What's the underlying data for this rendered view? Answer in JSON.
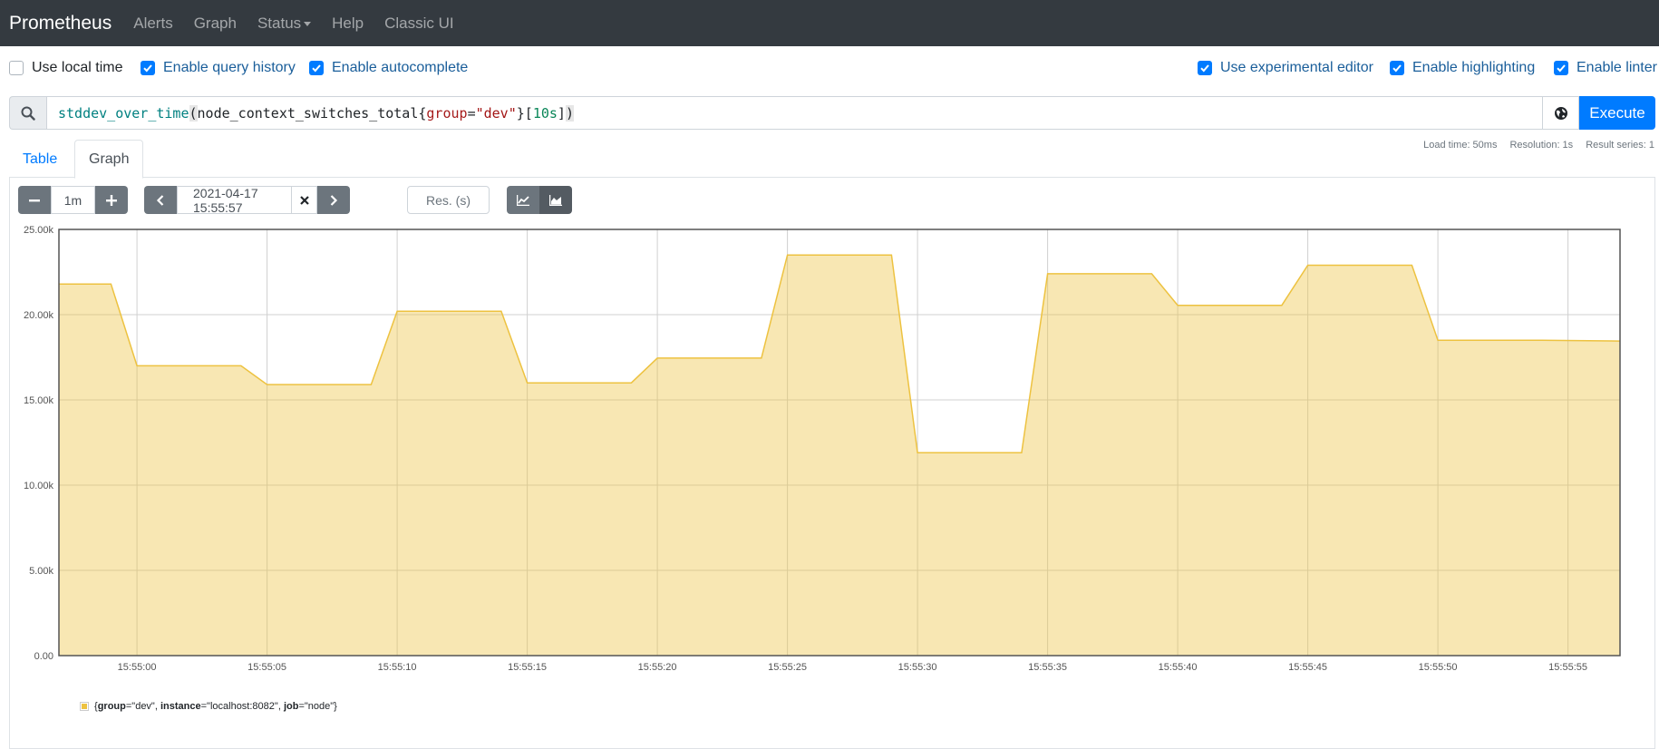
{
  "navbar": {
    "brand": "Prometheus",
    "links": [
      "Alerts",
      "Graph",
      "Status",
      "Help",
      "Classic UI"
    ]
  },
  "options": {
    "use_local_time": {
      "label": "Use local time",
      "checked": false
    },
    "enable_query_history": {
      "label": "Enable query history",
      "checked": true
    },
    "enable_autocomplete": {
      "label": "Enable autocomplete",
      "checked": true
    },
    "use_experimental_editor": {
      "label": "Use experimental editor",
      "checked": true
    },
    "enable_highlighting": {
      "label": "Enable highlighting",
      "checked": true
    },
    "enable_linter": {
      "label": "Enable linter",
      "checked": true
    }
  },
  "query": {
    "function": "stddev_over_time",
    "metric": "node_context_switches_total",
    "label_name": "group",
    "label_value": "\"dev\"",
    "range": "10s"
  },
  "execute_label": "Execute",
  "stats": {
    "load_time": "Load time: 50ms",
    "resolution": "Resolution: 1s",
    "result_series": "Result series: 1"
  },
  "tabs": [
    "Table",
    "Graph"
  ],
  "active_tab": "Graph",
  "graph_controls": {
    "range": "1m",
    "end_time": "2021-04-17 15:55:57",
    "resolution_placeholder": "Res. (s)",
    "stacked": true
  },
  "chart_data": {
    "type": "area",
    "x_range": [
      "15:54:57",
      "15:55:57"
    ],
    "ylim": [
      0,
      25000
    ],
    "y_ticks": [
      "0.00",
      "5.00k",
      "10.00k",
      "15.00k",
      "20.00k",
      "25.00k"
    ],
    "x_ticks": [
      "15:55:00",
      "15:55:05",
      "15:55:10",
      "15:55:15",
      "15:55:20",
      "15:55:25",
      "15:55:30",
      "15:55:35",
      "15:55:40",
      "15:55:45",
      "15:55:50",
      "15:55:55"
    ],
    "grid": true,
    "series": [
      {
        "name": "{group=\"dev\", instance=\"localhost:8082\", job=\"node\"}",
        "color": "#edc240",
        "x": [
          "15:54:57",
          "15:54:59",
          "15:55:00",
          "15:55:04",
          "15:55:05",
          "15:55:09",
          "15:55:10",
          "15:55:14",
          "15:55:15",
          "15:55:19",
          "15:55:20",
          "15:55:24",
          "15:55:25",
          "15:55:29",
          "15:55:30",
          "15:55:34",
          "15:55:35",
          "15:55:39",
          "15:55:40",
          "15:55:44",
          "15:55:45",
          "15:55:49",
          "15:55:50",
          "15:55:54",
          "15:55:57"
        ],
        "values": [
          21800,
          21800,
          17000,
          17000,
          15900,
          15900,
          20200,
          20200,
          16000,
          16000,
          17450,
          17450,
          23500,
          23500,
          11900,
          11900,
          22400,
          22400,
          20550,
          20550,
          22900,
          22900,
          18500,
          18500,
          18450
        ]
      }
    ]
  },
  "legend": {
    "parts": [
      {
        "key": "group",
        "value": "\"dev\""
      },
      {
        "key": "instance",
        "value": "\"localhost:8082\""
      },
      {
        "key": "job",
        "value": "\"node\""
      }
    ]
  }
}
